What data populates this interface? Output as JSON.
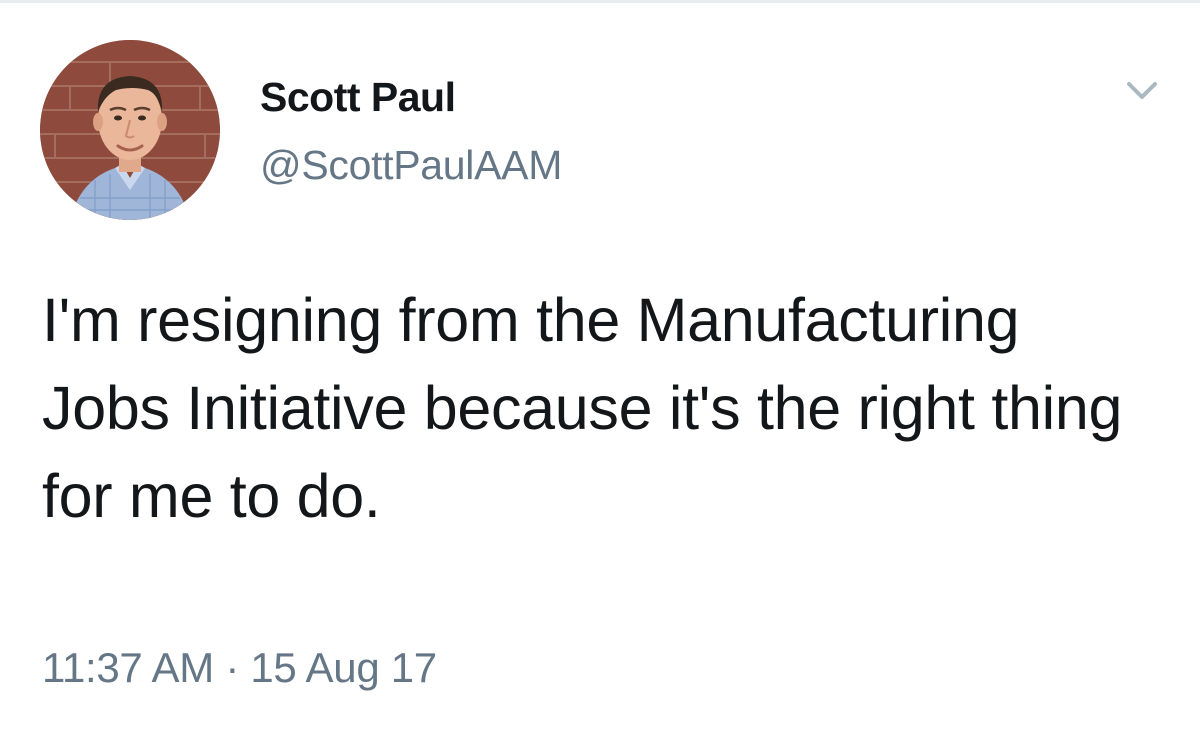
{
  "tweet": {
    "author": {
      "display_name": "Scott Paul",
      "handle": "@ScottPaulAAM",
      "avatar": "profile-photo"
    },
    "text": "I'm resigning from the Manufacturing Jobs Initiative because it's the right thing for me to do.",
    "time": "11:37 AM",
    "separator": "·",
    "date": "15 Aug 17",
    "menu_icon": "chevron-down-icon"
  },
  "colors": {
    "text_primary": "#14171a",
    "text_secondary": "#657786",
    "chevron": "#aab8c2",
    "background": "#ffffff"
  }
}
